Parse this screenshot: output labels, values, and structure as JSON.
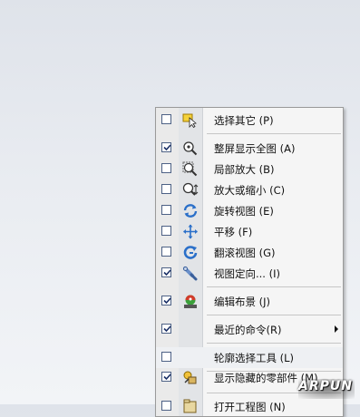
{
  "menu": {
    "items": [
      {
        "label": "选择其它 (P)",
        "checked": false,
        "icon": "select-other-icon"
      },
      {
        "label": "整屏显示全图 (A)",
        "checked": true,
        "icon": "zoom-to-fit-icon"
      },
      {
        "label": "局部放大 (B)",
        "checked": false,
        "icon": "zoom-to-area-icon"
      },
      {
        "label": "放大或缩小 (C)",
        "checked": false,
        "icon": "zoom-in-out-icon"
      },
      {
        "label": "旋转视图 (E)",
        "checked": false,
        "icon": "rotate-view-icon"
      },
      {
        "label": "平移 (F)",
        "checked": false,
        "icon": "pan-icon"
      },
      {
        "label": "翻滚视图 (G)",
        "checked": false,
        "icon": "roll-view-icon"
      },
      {
        "label": "视图定向... (I)",
        "checked": true,
        "icon": "view-orientation-icon"
      },
      {
        "label": "编辑布景 (J)",
        "checked": true,
        "icon": "edit-scene-icon"
      },
      {
        "label": "最近的命令(R)",
        "checked": true,
        "icon": "",
        "submenu": true
      },
      {
        "label": "轮廓选择工具 (L)",
        "checked": false,
        "icon": ""
      },
      {
        "label": "显示隐藏的零部件 (M)",
        "checked": true,
        "icon": "show-hidden-components-icon"
      },
      {
        "label": "打开工程图 (N)",
        "checked": false,
        "icon": "open-drawing-icon"
      }
    ]
  },
  "watermark": "ARPUN"
}
